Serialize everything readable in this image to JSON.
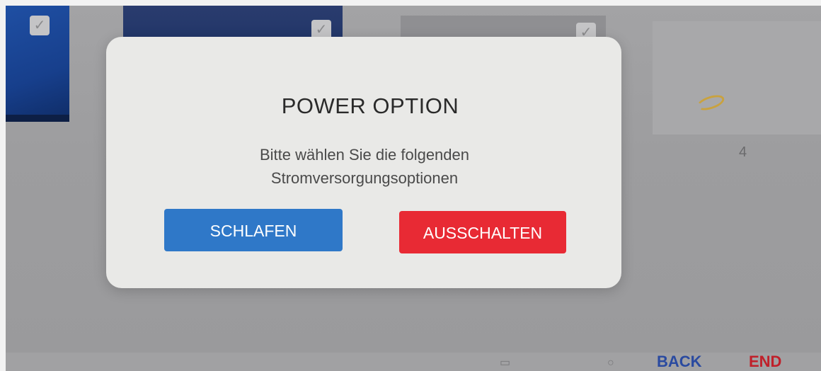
{
  "dialog": {
    "title": "POWER OPTION",
    "message_line1": "Bitte wählen Sie die folgenden",
    "message_line2": "Stromversorgungsoptionen",
    "sleep_label": "SCHLAFEN",
    "shutdown_label": "AUSSCHALTEN"
  },
  "background": {
    "page_number": "4",
    "nav": {
      "back_label": "BACK",
      "end_label": "END"
    }
  },
  "colors": {
    "sleep_button": "#2f78c8",
    "shutdown_button": "#e82a34",
    "dialog_bg": "#e9e9e7",
    "back_text": "#2a4aa0",
    "end_text": "#c0202a"
  },
  "icons": [
    "check-icon",
    "window-icon",
    "search-icon"
  ]
}
